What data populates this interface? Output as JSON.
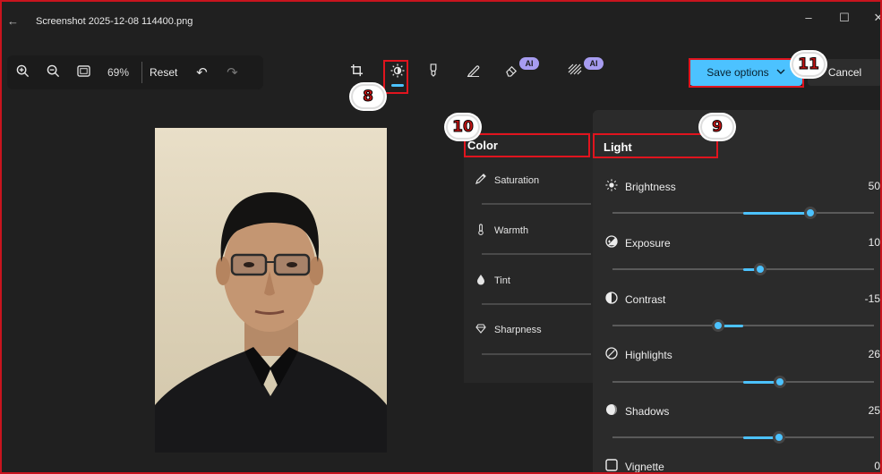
{
  "window": {
    "title": "Screenshot 2025-12-08 114400.png",
    "minimize": "–",
    "maximize": "☐",
    "close": "✕"
  },
  "toolbar": {
    "zoom_in_icon": "zoom-in",
    "zoom_out_icon": "zoom-out",
    "fit_icon": "fit-to-window",
    "zoom_value": "69%",
    "reset_label": "Reset",
    "undo_icon": "undo",
    "redo_icon": "redo"
  },
  "tools": {
    "crop": "crop",
    "adjust": "light-adjust",
    "markup": "markup",
    "draw": "draw",
    "erase": "generative-erase",
    "erase_badge": "AI",
    "background": "background",
    "background_badge": "AI"
  },
  "actions": {
    "save_label": "Save options",
    "cancel_label": "Cancel"
  },
  "annotations": {
    "badge_8": "8",
    "badge_9": "9",
    "badge_10": "10",
    "badge_11": "11"
  },
  "color_panel": {
    "header": "Color",
    "items": [
      {
        "label": "Saturation",
        "icon": "eyedropper"
      },
      {
        "label": "Warmth",
        "icon": "thermometer"
      },
      {
        "label": "Tint",
        "icon": "droplet"
      },
      {
        "label": "Sharpness",
        "icon": "diamond"
      }
    ]
  },
  "light_panel": {
    "header": "Light",
    "items": [
      {
        "label": "Brightness",
        "value": "50",
        "icon": "sun"
      },
      {
        "label": "Exposure",
        "value": "10",
        "icon": "exposure"
      },
      {
        "label": "Contrast",
        "value": "-15",
        "icon": "contrast"
      },
      {
        "label": "Highlights",
        "value": "26",
        "icon": "highlights"
      },
      {
        "label": "Shadows",
        "value": "25",
        "icon": "shadows"
      },
      {
        "label": "Vignette",
        "value": "0",
        "icon": "vignette"
      }
    ]
  },
  "colors": {
    "accent": "#4cc2ff",
    "annotation_red": "#e0141e",
    "ai_badge": "#a79cf0"
  }
}
